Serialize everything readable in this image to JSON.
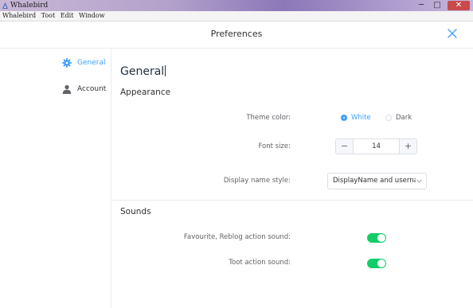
{
  "window": {
    "title": "Whalebird",
    "controls": {
      "minimize": "─",
      "maximize": "□",
      "close": "✕"
    }
  },
  "menu": {
    "items": [
      "Whalebird",
      "Toot",
      "Edit",
      "Window"
    ]
  },
  "dialog": {
    "title": "Preferences",
    "close_icon": "close-icon"
  },
  "sidebar": {
    "items": [
      {
        "label": "General",
        "icon": "gear-icon",
        "active": true
      },
      {
        "label": "Account",
        "icon": "user-icon",
        "active": false
      }
    ]
  },
  "main": {
    "title": "General",
    "appearance": {
      "section_title": "Appearance",
      "theme": {
        "label": "Theme color:",
        "options": [
          "White",
          "Dark"
        ],
        "selected": "White"
      },
      "font_size": {
        "label": "Font size:",
        "value": "14",
        "decrement": "−",
        "increment": "+"
      },
      "display_name": {
        "label": "Display name style:",
        "value": "DisplayName and usernam"
      }
    },
    "sounds": {
      "section_title": "Sounds",
      "fav_reblog": {
        "label": "Favourite, Reblog action sound:",
        "enabled": true
      },
      "toot": {
        "label": "Toot action sound:",
        "enabled": true
      }
    }
  },
  "colors": {
    "accent": "#409eff",
    "switch_on": "#13ce66",
    "window_close": "#c94a4a"
  }
}
